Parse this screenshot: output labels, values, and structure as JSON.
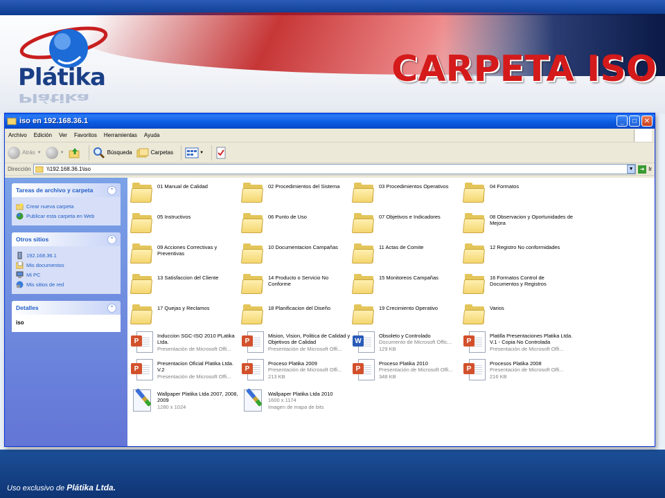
{
  "slide": {
    "title": "CARPETA ISO",
    "logo_text": "Plátika",
    "footer_prefix": "Uso exclusivo de ",
    "footer_brand": "Plátika Ltda."
  },
  "window": {
    "title": "iso en 192.168.36.1",
    "menu": [
      "Archivo",
      "Edición",
      "Ver",
      "Favoritos",
      "Herramientas",
      "Ayuda"
    ],
    "toolbar": {
      "back": "Atrás",
      "search": "Búsqueda",
      "folders": "Carpetas"
    },
    "address": {
      "label": "Dirección",
      "value": "\\\\192.168.36.1\\iso",
      "go": "Ir"
    }
  },
  "taskpane": {
    "tasks": {
      "title": "Tareas de archivo y carpeta",
      "items": [
        "Crear nueva carpeta",
        "Publicar esta carpeta en Web"
      ]
    },
    "other": {
      "title": "Otros sitios",
      "items": [
        "192.168.36.1",
        "Mis documentos",
        "Mi PC",
        "Mis sitios de red"
      ]
    },
    "details": {
      "title": "Detalles",
      "value": "iso"
    }
  },
  "items": [
    {
      "name": "01 Manual de Calidad",
      "kind": "folder"
    },
    {
      "name": "02 Procedimientos del Sistema",
      "kind": "folder"
    },
    {
      "name": "03 Procedimientos Operativos",
      "kind": "folder"
    },
    {
      "name": "04 Formatos",
      "kind": "folder"
    },
    {
      "name": "05 Instructivos",
      "kind": "folder"
    },
    {
      "name": "06 Punto de Uso",
      "kind": "folder"
    },
    {
      "name": "07 Objetivos e Indicadores",
      "kind": "folder"
    },
    {
      "name": "08 Observacion y Oportunidades de Mejora",
      "kind": "folder"
    },
    {
      "name": "09 Acciones Correctivas y Preventivas",
      "kind": "folder"
    },
    {
      "name": "10 Documentacion Campañas",
      "kind": "folder"
    },
    {
      "name": "11 Actas de Comite",
      "kind": "folder"
    },
    {
      "name": "12 Registro No conformidades",
      "kind": "folder"
    },
    {
      "name": "13 Satisfaccion del Cliente",
      "kind": "folder"
    },
    {
      "name": "14 Producto o Servicio No Conforme",
      "kind": "folder"
    },
    {
      "name": "15 Monitoreos Campañas",
      "kind": "folder"
    },
    {
      "name": "16 Formatos Control de Documentos y Registros",
      "kind": "folder"
    },
    {
      "name": "17 Quejas y Reclamos",
      "kind": "folder"
    },
    {
      "name": "18 Planificacion del Diseño",
      "kind": "folder"
    },
    {
      "name": "19 Crecimiento Operativo",
      "kind": "folder"
    },
    {
      "name": "Varios",
      "kind": "folder"
    },
    {
      "name": "Induccion SGC-ISO 2010 PLatika Ltda.",
      "kind": "ppt",
      "type": "Presentación de Microsoft Offi...",
      "size": ""
    },
    {
      "name": "Mision, Vision, Politica de Calidad y Objetivos de Calidad",
      "kind": "ppt",
      "type": "Presentación de Microsoft Offi...",
      "size": ""
    },
    {
      "name": "Obsoleto y Controlado",
      "kind": "word",
      "type": "Documento de Microsoft Offic...",
      "size": "129 KB"
    },
    {
      "name": "Platilla Presentaciones Platika Ltda. V.1 - Copia No Controlada",
      "kind": "ppt",
      "type": "Presentación de Microsoft Offi...",
      "size": ""
    },
    {
      "name": "Presentacion Oficial Platika Ltda. V.2",
      "kind": "ppt",
      "type": "Presentación de Microsoft Offi...",
      "size": ""
    },
    {
      "name": "Proceso Platika 2009",
      "kind": "ppt",
      "type": "Presentación de Microsoft Offi...",
      "size": "213 KB"
    },
    {
      "name": "Proceso Platika 2010",
      "kind": "ppt",
      "type": "Presentación de Microsoft Offi...",
      "size": "348 KB"
    },
    {
      "name": "Procesos Platika 2008",
      "kind": "ppt",
      "type": "Presentación de Microsoft Offi...",
      "size": "216 KB"
    },
    {
      "name": "Wallpaper Platika Ltda 2007, 2008, 2009",
      "kind": "bmp",
      "type": "1280 x 1024",
      "size": ""
    },
    {
      "name": "Wallpaper Platika Ltda 2010",
      "kind": "bmp",
      "type": "1600 x 1174",
      "size": "Imagen de mapa de bits"
    }
  ],
  "colors": {
    "title_red": "#d41a1a",
    "xp_blue": "#0a5be0",
    "link_blue": "#215dc6"
  }
}
